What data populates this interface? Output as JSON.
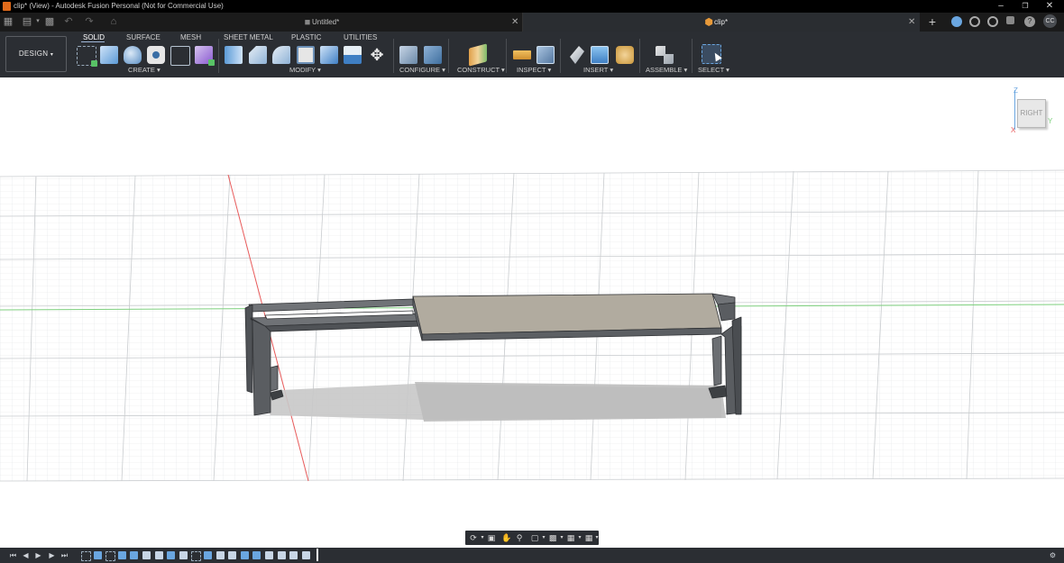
{
  "window": {
    "title": "clip* (View) - Autodesk Fusion Personal (Not for Commercial Use)",
    "minimize": "–",
    "restore": "❐",
    "close": "✕"
  },
  "tabs": [
    {
      "label": "Untitled*",
      "active": false
    },
    {
      "label": "clip*",
      "active": true
    }
  ],
  "tabbar": {
    "new_tab": "+",
    "user_initials": "CC",
    "help": "?"
  },
  "toolbar": {
    "workspace": "DESIGN",
    "workspace_tabs": [
      "SOLID",
      "SURFACE",
      "MESH",
      "SHEET METAL",
      "PLASTIC",
      "UTILITIES"
    ],
    "groups": [
      "CREATE",
      "MODIFY",
      "CONFIGURE",
      "CONSTRUCT",
      "INSPECT",
      "INSERT",
      "ASSEMBLE",
      "SELECT"
    ]
  },
  "viewcube": {
    "face": "RIGHT",
    "z_axis": "Z",
    "y_axis": "Y",
    "x_axis": "X"
  },
  "colors": {
    "accent": "#6aa6e0",
    "title_bg": "#000000",
    "toolbar_bg": "#2b2e33",
    "model_face": "#b1ab9f",
    "model_dark": "#5c5f63",
    "red_axis": "#e85a5a",
    "green_axis": "#7ed07e"
  }
}
